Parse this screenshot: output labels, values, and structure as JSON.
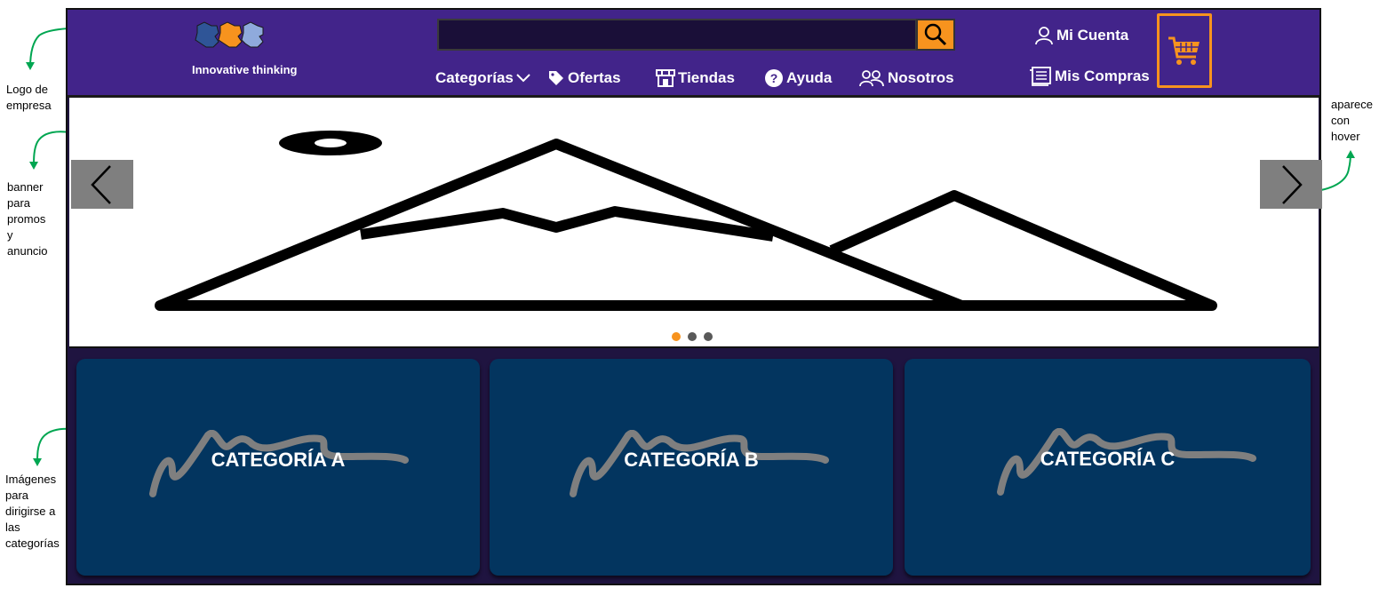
{
  "annotations": {
    "logo": "Logo de empresa",
    "banner": "banner para promos y anuncio",
    "hover": "aparece con hover",
    "categories": "Imágenes para dirigirse a las categorías"
  },
  "header": {
    "logo_text": "Innovative thinking",
    "search": {
      "value": "",
      "placeholder": ""
    },
    "nav": [
      {
        "label": "Categorías",
        "icon": "chevron-down-icon"
      },
      {
        "label": "Ofertas",
        "icon": "tag-icon"
      },
      {
        "label": "Tiendas",
        "icon": "store-icon"
      },
      {
        "label": "Ayuda",
        "icon": "help-icon"
      },
      {
        "label": "Nosotros",
        "icon": "users-icon"
      }
    ],
    "account": {
      "label": "Mi Cuenta",
      "icon": "user-icon"
    },
    "purchases": {
      "label": "Mis Compras",
      "icon": "receipt-icon"
    },
    "cart_icon": "cart-icon"
  },
  "banner": {
    "prev_icon": "chevron-left-icon",
    "next_icon": "chevron-right-icon",
    "slides": 3,
    "active_slide": 1
  },
  "categories": [
    {
      "label": "CATEGORÍA A"
    },
    {
      "label": "CATEGORÍA B"
    },
    {
      "label": "CATEGORÍA C"
    }
  ],
  "colors": {
    "header_bg": "#42248a",
    "page_bg": "#1f1440",
    "accent": "#f7931e",
    "card_bg": "#03355f",
    "annotation_arrow": "#00a651"
  }
}
